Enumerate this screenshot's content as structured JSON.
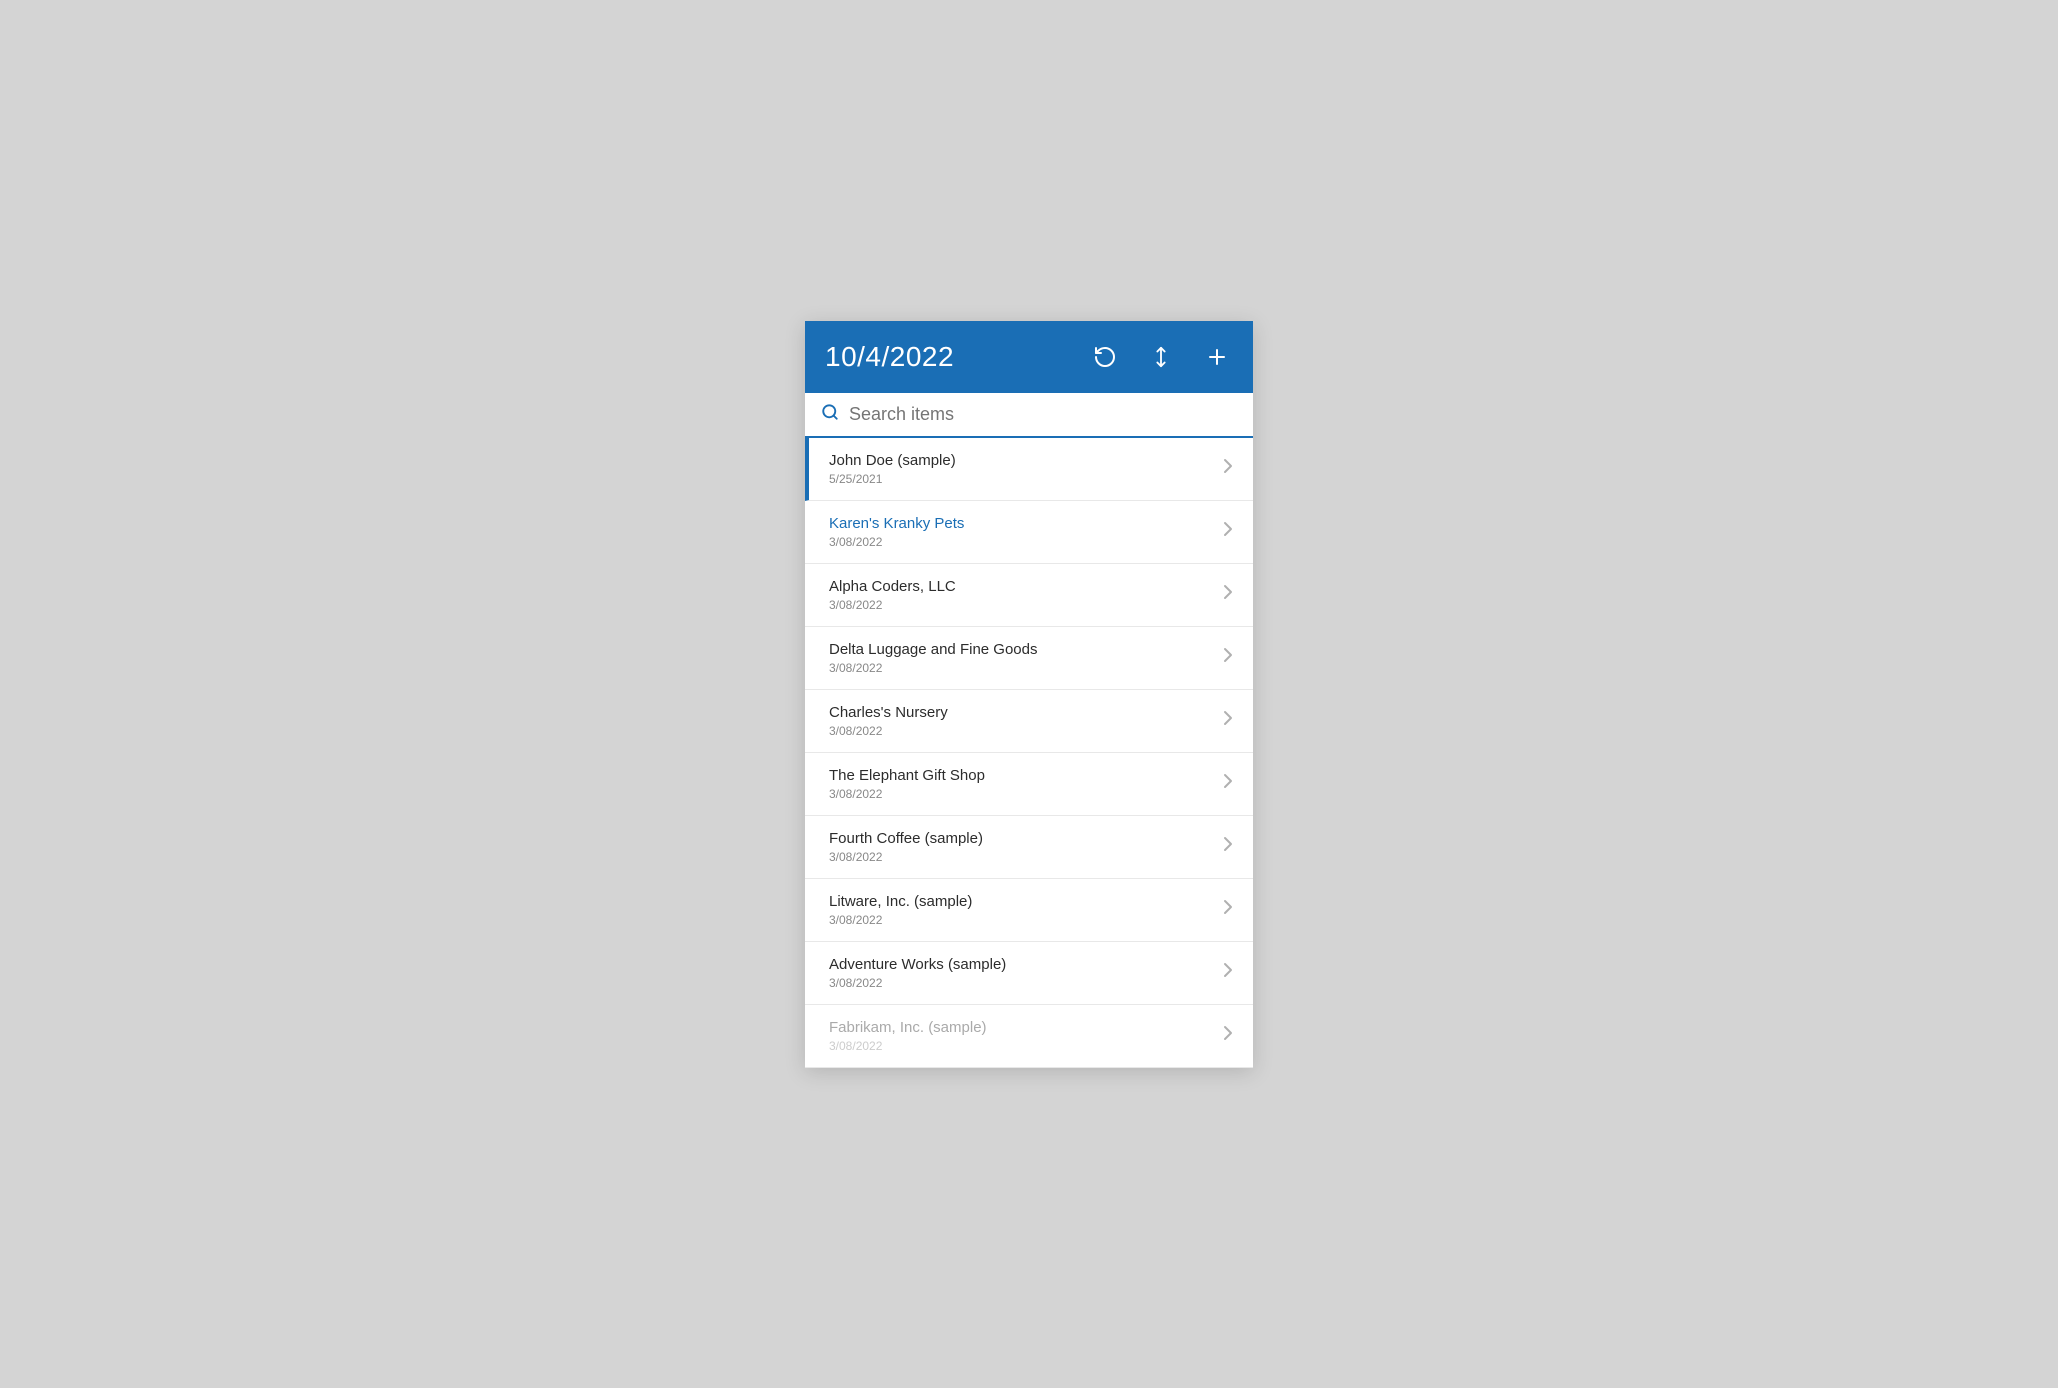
{
  "header": {
    "date": "10/4/2022",
    "icons": {
      "refresh": "↺",
      "sort": "⇅",
      "add": "+"
    }
  },
  "search": {
    "placeholder": "Search items"
  },
  "list": [
    {
      "name": "John Doe (sample)",
      "date": "5/25/2021",
      "selected": true,
      "link": false
    },
    {
      "name": "Karen's Kranky Pets",
      "date": "3/08/2022",
      "selected": false,
      "link": true
    },
    {
      "name": "Alpha Coders, LLC",
      "date": "3/08/2022",
      "selected": false,
      "link": false
    },
    {
      "name": "Delta Luggage and Fine Goods",
      "date": "3/08/2022",
      "selected": false,
      "link": false
    },
    {
      "name": "Charles's Nursery",
      "date": "3/08/2022",
      "selected": false,
      "link": false
    },
    {
      "name": "The Elephant Gift Shop",
      "date": "3/08/2022",
      "selected": false,
      "link": false
    },
    {
      "name": "Fourth Coffee (sample)",
      "date": "3/08/2022",
      "selected": false,
      "link": false
    },
    {
      "name": "Litware, Inc. (sample)",
      "date": "3/08/2022",
      "selected": false,
      "link": false
    },
    {
      "name": "Adventure Works (sample)",
      "date": "3/08/2022",
      "selected": false,
      "link": false
    },
    {
      "name": "Fabrikam, Inc. (sample)",
      "date": "3/08/2022",
      "selected": false,
      "link": false,
      "partial": true
    }
  ]
}
